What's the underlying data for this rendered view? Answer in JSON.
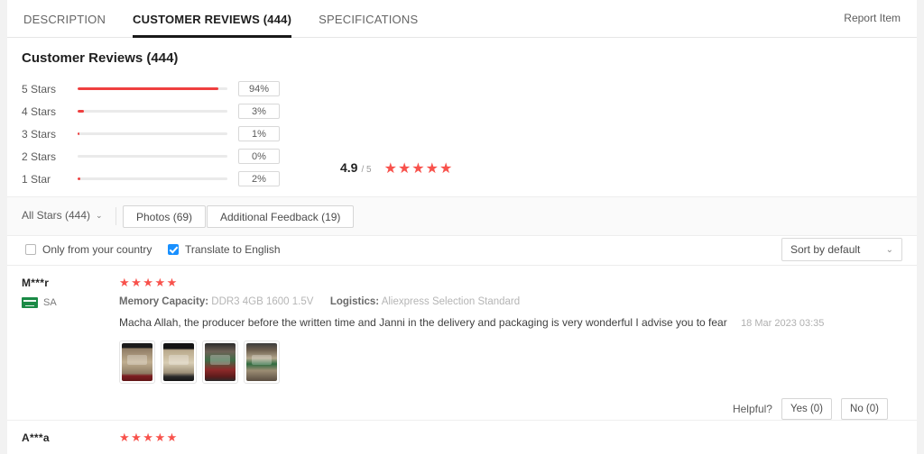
{
  "tabs": [
    {
      "label": "DESCRIPTION",
      "active": false
    },
    {
      "label": "CUSTOMER REVIEWS (444)",
      "active": true
    },
    {
      "label": "SPECIFICATIONS",
      "active": false
    }
  ],
  "header": {
    "report_item": "Report Item"
  },
  "summary": {
    "title": "Customer Reviews (444)",
    "score": "4.9",
    "score_denominator": "/ 5",
    "stars": "★★★★★",
    "breakdown": [
      {
        "label": "5 Stars",
        "percent": "94%",
        "value": 94
      },
      {
        "label": "4 Stars",
        "percent": "3%",
        "value": 3
      },
      {
        "label": "3 Stars",
        "percent": "1%",
        "value": 1
      },
      {
        "label": "2 Stars",
        "percent": "0%",
        "value": 0
      },
      {
        "label": "1 Star",
        "percent": "2%",
        "value": 2
      }
    ]
  },
  "filters": {
    "all_stars": "All Stars (444)",
    "caret": "⌄",
    "photos": "Photos (69)",
    "additional_feedback": "Additional Feedback (19)"
  },
  "options": {
    "only_country": "Only from your country",
    "only_country_checked": false,
    "translate": "Translate to English",
    "translate_checked": true,
    "sort": "Sort by default",
    "sort_caret": "⌄"
  },
  "reviews": [
    {
      "user": "M***r",
      "country": "SA",
      "stars": "★★★★★",
      "spec_label_1": "Memory Capacity:",
      "spec_value_1": "DDR3 4GB 1600 1.5V",
      "spec_label_2": "Logistics:",
      "spec_value_2": "Aliexpress Selection Standard",
      "body": "Macha Allah, the producer before the written time and Janni in the delivery and packaging is very wonderful I advise you to fear",
      "date": "18 Mar 2023 03:35",
      "photo_count": 4,
      "helpful_label": "Helpful?",
      "yes": "Yes (0)",
      "no": "No (0)"
    },
    {
      "user": "A***a",
      "stars": "★★★★★"
    }
  ]
}
